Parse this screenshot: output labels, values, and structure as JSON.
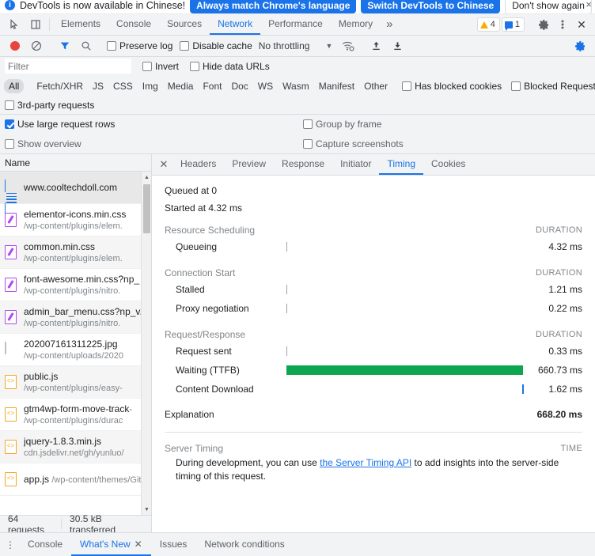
{
  "banner": {
    "text": "DevTools is now available in Chinese!",
    "primary_button": "Always match Chrome's language",
    "secondary_button": "Switch DevTools to Chinese",
    "dismiss_button": "Don't show again",
    "close": "×"
  },
  "main_tabs": {
    "items": [
      "Elements",
      "Console",
      "Sources",
      "Network",
      "Performance",
      "Memory"
    ],
    "active": "Network",
    "more": "»",
    "warning_count": "4",
    "message_count": "1",
    "close": "✕"
  },
  "network_toolbar": {
    "preserve_log": "Preserve log",
    "disable_cache": "Disable cache",
    "throttling": "No throttling",
    "caret": "▼"
  },
  "filter_bar": {
    "placeholder": "Filter",
    "value": "",
    "invert": "Invert",
    "hide_data_urls": "Hide data URLs"
  },
  "type_filters": {
    "items": [
      "All",
      "Fetch/XHR",
      "JS",
      "CSS",
      "Img",
      "Media",
      "Font",
      "Doc",
      "WS",
      "Wasm",
      "Manifest",
      "Other"
    ],
    "active": "All",
    "has_blocked_cookies": "Has blocked cookies",
    "blocked_requests": "Blocked Requests",
    "third_party_requests": "3rd-party requests"
  },
  "options": {
    "use_large_request_rows": "Use large request rows",
    "use_large_request_rows_checked": true,
    "show_overview": "Show overview",
    "show_overview_checked": false,
    "group_by_frame": "Group by frame",
    "group_by_frame_checked": false,
    "capture_screenshots": "Capture screenshots",
    "capture_screenshots_checked": false
  },
  "request_list": {
    "header": "Name",
    "rows": [
      {
        "name": "www.cooltechdoll.com",
        "url": "",
        "icon": "document-icon",
        "selected": true
      },
      {
        "name": "elementor-icons.min.css",
        "url": "/wp-content/plugins/elem.",
        "icon": "stylesheet-icon",
        "selected": false
      },
      {
        "name": "common.min.css",
        "url": "/wp-content/plugins/elem.",
        "icon": "stylesheet-icon",
        "selected": false
      },
      {
        "name": "font-awesome.min.css?np_",
        "url": "/wp-content/plugins/nitro.",
        "icon": "stylesheet-icon",
        "selected": false
      },
      {
        "name": "admin_bar_menu.css?np_v.",
        "url": "/wp-content/plugins/nitro.",
        "icon": "stylesheet-icon",
        "selected": false
      },
      {
        "name": "202007161311225.jpg",
        "url": "/wp-content/uploads/2020",
        "icon": "image-icon",
        "selected": false
      },
      {
        "name": "public.js",
        "url": "/wp-content/plugins/easy-",
        "icon": "script-icon",
        "selected": false
      },
      {
        "name": "gtm4wp-form-move-track·",
        "url": "/wp-content/plugins/durac",
        "icon": "script-icon",
        "selected": false
      },
      {
        "name": "jquery-1.8.3.min.js",
        "url": "cdn.jsdelivr.net/gh/yunluo/",
        "icon": "script-icon",
        "selected": false
      },
      {
        "name": "app.js",
        "url": "/wp-content/themes/Git-a",
        "icon": "script-icon",
        "selected": false
      }
    ],
    "footer_requests": "64 requests",
    "footer_transferred": "30.5 kB transferred"
  },
  "detail_tabs": {
    "items": [
      "Headers",
      "Preview",
      "Response",
      "Initiator",
      "Timing",
      "Cookies"
    ],
    "active": "Timing",
    "close": "✕"
  },
  "timing": {
    "queued_at": "Queued at 0",
    "started_at": "Started at 4.32 ms",
    "duration_header": "DURATION",
    "time_header": "TIME",
    "sections": [
      {
        "title": "Resource Scheduling",
        "rows": [
          {
            "label": "Queueing",
            "value": "4.32 ms",
            "bar_type": "tick",
            "bar_left_pct": 0.5,
            "bar_width_pct": 0.6
          }
        ]
      },
      {
        "title": "Connection Start",
        "rows": [
          {
            "label": "Stalled",
            "value": "1.21 ms",
            "bar_type": "tick",
            "bar_left_pct": 0.5,
            "bar_width_pct": 0.6
          },
          {
            "label": "Proxy negotiation",
            "value": "0.22 ms",
            "bar_type": "tick",
            "bar_left_pct": 0.5,
            "bar_width_pct": 0.6
          }
        ]
      },
      {
        "title": "Request/Response",
        "rows": [
          {
            "label": "Request sent",
            "value": "0.33 ms",
            "bar_type": "tick",
            "bar_left_pct": 0.5,
            "bar_width_pct": 0.6
          },
          {
            "label": "Waiting (TTFB)",
            "value": "660.73 ms",
            "bar_type": "green",
            "bar_left_pct": 0.5,
            "bar_width_pct": 98.5
          },
          {
            "label": "Content Download",
            "value": "1.62 ms",
            "bar_type": "blue",
            "bar_left_pct": 99.0,
            "bar_width_pct": 0.7
          }
        ]
      }
    ],
    "explanation_link": "Explanation",
    "total": "668.20 ms",
    "server_timing_title": "Server Timing",
    "server_timing_note_before": "During development, you can use ",
    "server_timing_link": "the Server Timing API",
    "server_timing_note_after": " to add insights into the server-side timing of this request."
  },
  "drawer": {
    "items": [
      "Console",
      "What's New",
      "Issues",
      "Network conditions"
    ],
    "active": "What's New",
    "active_close": "✕",
    "menu": "⋮"
  },
  "colors": {
    "accent": "#1a73e8",
    "ttfb_green": "#0ba750",
    "download_blue": "#1a73e8",
    "warning_yellow": "#f9ab00",
    "record_red": "#e8453c",
    "toolbar_bg": "#f1f3f4",
    "css_purple": "#b14aed",
    "js_orange": "#f5a623"
  }
}
